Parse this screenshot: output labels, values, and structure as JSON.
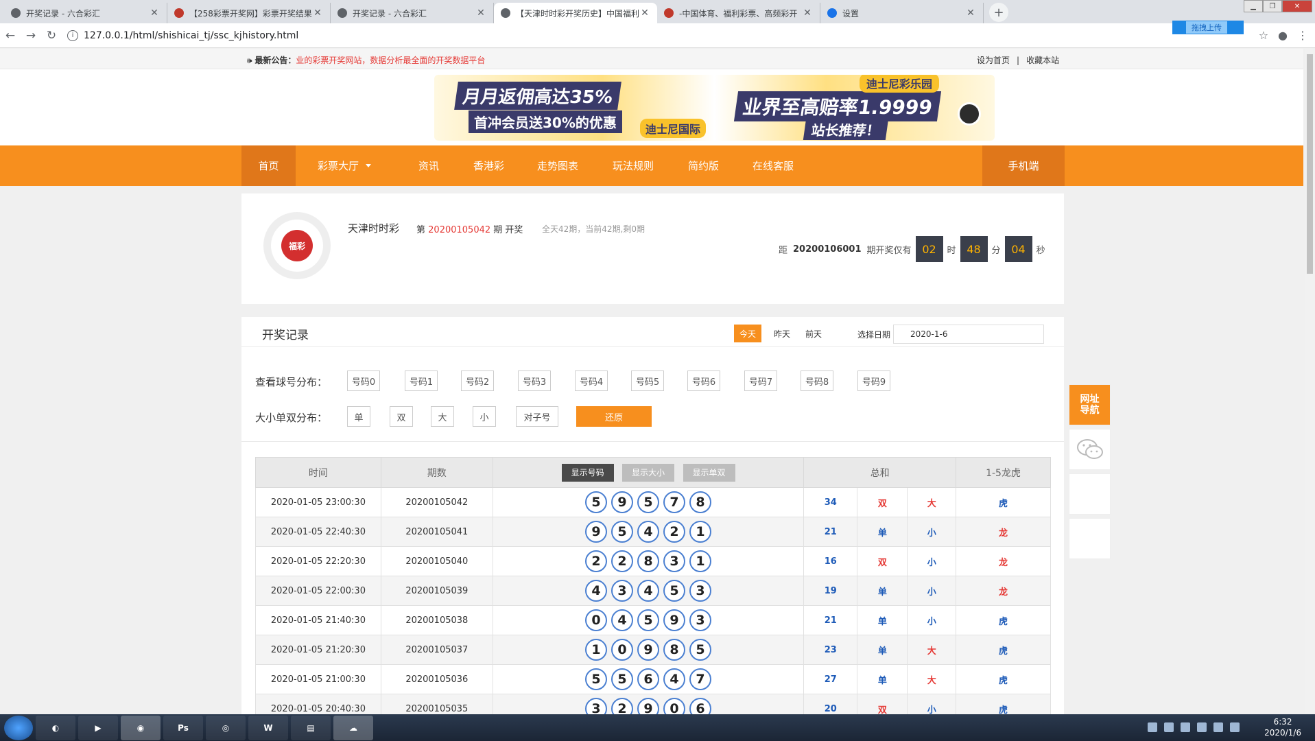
{
  "browser": {
    "tabs": [
      {
        "title": "开奖记录 - 六合彩汇",
        "icon": "globe-icon",
        "active": false
      },
      {
        "title": "【258彩票开奖网】彩票开奖结果",
        "icon": "site-logo-icon",
        "active": false
      },
      {
        "title": "开奖记录 - 六合彩汇",
        "icon": "globe-icon",
        "active": false
      },
      {
        "title": "【天津时时彩开奖历史】中国福利",
        "icon": "globe-icon",
        "active": true
      },
      {
        "title": "-中国体育、福利彩票、高频彩开",
        "icon": "site-logo-icon",
        "active": false
      },
      {
        "title": "设置",
        "icon": "gear-icon",
        "active": false
      }
    ],
    "url": "127.0.0.1/html/shishicai_tj/ssc_kjhistory.html",
    "upload_label": "拖拽上传"
  },
  "notice": {
    "label": "最新公告：",
    "text": "业的彩票开奖网站，数据分析最全面的开奖数据平台",
    "set_home": "设为首页",
    "bookmark": "收藏本站"
  },
  "banner": {
    "line1": "月月返佣高达35%",
    "line2": "首冲会员送30%的优惠",
    "brand": "迪士尼国际",
    "line3": "业界至高赔率1.9999",
    "club": "迪士尼彩乐园",
    "line4": "站长推荐！"
  },
  "nav": {
    "home": "首页",
    "hall": "彩票大厅",
    "news": "资讯",
    "hk": "香港彩",
    "trend": "走势图表",
    "rules": "玩法规则",
    "simple": "简约版",
    "service": "在线客服",
    "mobile": "手机端"
  },
  "lottery": {
    "name": "天津时时彩",
    "prefix": "第",
    "issue": "20200105042",
    "suffix": "期 开奖",
    "summary": "全天42期，当前42期,剩0期",
    "dist_label": "距",
    "next_issue": "20200106001",
    "next_label": "期开奖仅有",
    "hours": "02",
    "h_unit": "时",
    "minutes": "48",
    "m_unit": "分",
    "seconds": "04",
    "s_unit": "秒"
  },
  "records": {
    "title": "开奖记录",
    "today": "今天",
    "yesterday": "昨天",
    "before_yesterday": "前天",
    "date_label": "选择日期",
    "date_value": "2020-1-6",
    "ball_dist_label": "查看球号分布：",
    "ball_buttons": [
      "号码0",
      "号码1",
      "号码2",
      "号码3",
      "号码4",
      "号码5",
      "号码6",
      "号码7",
      "号码8",
      "号码9"
    ],
    "size_dist_label": "大小单双分布：",
    "size_buttons": [
      "单",
      "双",
      "大",
      "小",
      "对子号"
    ],
    "reset": "还原"
  },
  "table": {
    "headers": {
      "time": "时间",
      "issue": "期数",
      "show_numbers": "显示号码",
      "show_size": "显示大小",
      "show_parity": "显示单双",
      "sum": "总和",
      "dragon_tiger": "1-5龙虎"
    },
    "rows": [
      {
        "time": "2020-01-05 23:00:30",
        "issue": "20200105042",
        "balls": [
          "5",
          "9",
          "5",
          "7",
          "8"
        ],
        "sum": "34",
        "parity": "双",
        "size": "大",
        "dt": "虎"
      },
      {
        "time": "2020-01-05 22:40:30",
        "issue": "20200105041",
        "balls": [
          "9",
          "5",
          "4",
          "2",
          "1"
        ],
        "sum": "21",
        "parity": "单",
        "size": "小",
        "dt": "龙"
      },
      {
        "time": "2020-01-05 22:20:30",
        "issue": "20200105040",
        "balls": [
          "2",
          "2",
          "8",
          "3",
          "1"
        ],
        "sum": "16",
        "parity": "双",
        "size": "小",
        "dt": "龙"
      },
      {
        "time": "2020-01-05 22:00:30",
        "issue": "20200105039",
        "balls": [
          "4",
          "3",
          "4",
          "5",
          "3"
        ],
        "sum": "19",
        "parity": "单",
        "size": "小",
        "dt": "龙"
      },
      {
        "time": "2020-01-05 21:40:30",
        "issue": "20200105038",
        "balls": [
          "0",
          "4",
          "5",
          "9",
          "3"
        ],
        "sum": "21",
        "parity": "单",
        "size": "小",
        "dt": "虎"
      },
      {
        "time": "2020-01-05 21:20:30",
        "issue": "20200105037",
        "balls": [
          "1",
          "0",
          "9",
          "8",
          "5"
        ],
        "sum": "23",
        "parity": "单",
        "size": "大",
        "dt": "虎"
      },
      {
        "time": "2020-01-05 21:00:30",
        "issue": "20200105036",
        "balls": [
          "5",
          "5",
          "6",
          "4",
          "7"
        ],
        "sum": "27",
        "parity": "单",
        "size": "大",
        "dt": "虎"
      },
      {
        "time": "2020-01-05 20:40:30",
        "issue": "20200105035",
        "balls": [
          "3",
          "2",
          "9",
          "0",
          "6"
        ],
        "sum": "20",
        "parity": "双",
        "size": "小",
        "dt": "虎"
      }
    ]
  },
  "side": {
    "nav_label": "网址导航"
  },
  "taskbar": {
    "time": "6:32",
    "date": "2020/1/6"
  },
  "colors": {
    "orange": "#f78f1e",
    "red": "#e53935",
    "blue": "#1e5bb8",
    "ball_border": "#4a7fd1"
  }
}
